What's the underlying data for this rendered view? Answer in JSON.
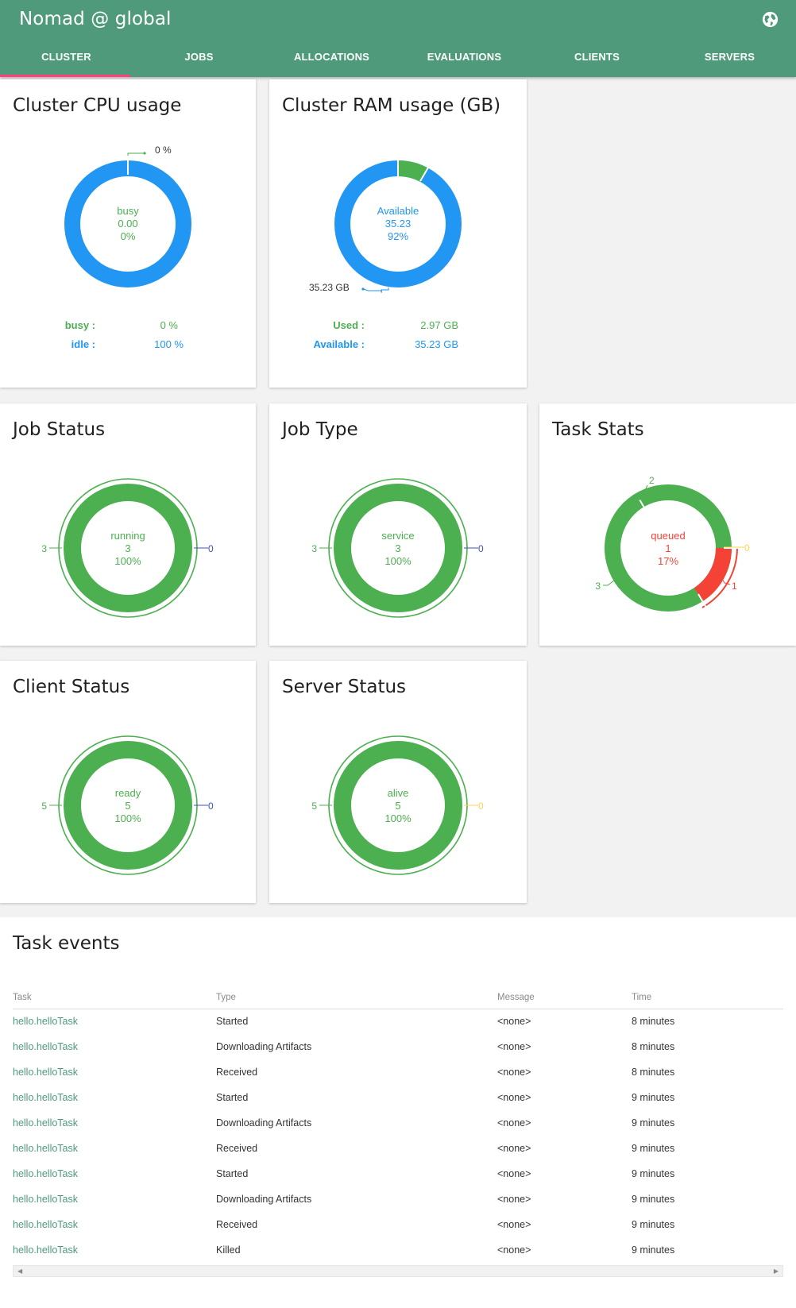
{
  "app": {
    "title": "Nomad @ global",
    "globe_icon": "globe-icon"
  },
  "tabs": [
    "CLUSTER",
    "JOBS",
    "ALLOCATIONS",
    "EVALUATIONS",
    "CLIENTS",
    "SERVERS"
  ],
  "colors": {
    "header": "#4e9a7a",
    "accent": "#ff4081",
    "green": "#4caf50",
    "blue": "#2196f3",
    "red": "#f44336",
    "yellow": "#ffd54f",
    "indigo": "#3f51b5"
  },
  "cpu": {
    "title": "Cluster CPU usage",
    "callout": "0 %",
    "center": {
      "label": "busy",
      "value": "0.00",
      "percent": "0%"
    },
    "stats": [
      {
        "label": "busy :",
        "value": "0 %"
      },
      {
        "label": "idle :",
        "value": "100 %"
      }
    ]
  },
  "ram": {
    "title": "Cluster RAM usage (GB)",
    "callout": "35.23 GB",
    "center": {
      "label": "Available",
      "value": "35.23",
      "percent": "92%"
    },
    "stats": [
      {
        "label": "Used :",
        "value": "2.97 GB"
      },
      {
        "label": "Available :",
        "value": "35.23 GB"
      }
    ]
  },
  "job_status": {
    "title": "Job Status",
    "center": {
      "label": "running",
      "value": "3",
      "percent": "100%"
    },
    "left": "3",
    "right": "0"
  },
  "job_type": {
    "title": "Job Type",
    "center": {
      "label": "service",
      "value": "3",
      "percent": "100%"
    },
    "left": "3",
    "right": "0"
  },
  "task_stats": {
    "title": "Task Stats",
    "center": {
      "label": "queued",
      "value": "1",
      "percent": "17%"
    },
    "callouts": [
      "2",
      "0",
      "1",
      "3"
    ]
  },
  "client_status": {
    "title": "Client Status",
    "center": {
      "label": "ready",
      "value": "5",
      "percent": "100%"
    },
    "left": "5",
    "right": "0"
  },
  "server_status": {
    "title": "Server Status",
    "center": {
      "label": "alive",
      "value": "5",
      "percent": "100%"
    },
    "left": "5",
    "right": "0"
  },
  "events": {
    "title": "Task events",
    "columns": [
      "Task",
      "Type",
      "Message",
      "Time"
    ],
    "rows": [
      [
        "hello.helloTask",
        "Started",
        "<none>",
        "8 minutes"
      ],
      [
        "hello.helloTask",
        "Downloading Artifacts",
        "<none>",
        "8 minutes"
      ],
      [
        "hello.helloTask",
        "Received",
        "<none>",
        "8 minutes"
      ],
      [
        "hello.helloTask",
        "Started",
        "<none>",
        "9 minutes"
      ],
      [
        "hello.helloTask",
        "Downloading Artifacts",
        "<none>",
        "9 minutes"
      ],
      [
        "hello.helloTask",
        "Received",
        "<none>",
        "9 minutes"
      ],
      [
        "hello.helloTask",
        "Started",
        "<none>",
        "9 minutes"
      ],
      [
        "hello.helloTask",
        "Downloading Artifacts",
        "<none>",
        "9 minutes"
      ],
      [
        "hello.helloTask",
        "Received",
        "<none>",
        "9 minutes"
      ],
      [
        "hello.helloTask",
        "Killed",
        "<none>",
        "9 minutes"
      ]
    ]
  }
}
